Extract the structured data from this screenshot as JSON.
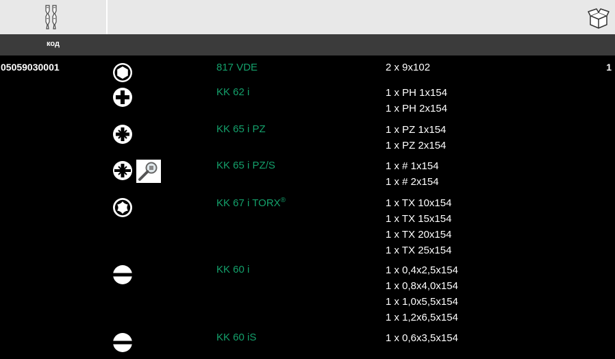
{
  "header": {
    "code_label": "код",
    "bits_icon": "screwdriver-bits-icon",
    "box_icon": "package-box-icon"
  },
  "product": {
    "article": "05059030001",
    "quantity": "1"
  },
  "rows": [
    {
      "icon": "hex-icon",
      "name": "817 VDE",
      "specs": [
        "2 x 9x102"
      ]
    },
    {
      "icon": "phillips-icon",
      "name": "KK 62 i",
      "specs": [
        "1 x PH 1x154",
        "1 x PH 2x154"
      ]
    },
    {
      "icon": "pozidriv-icon",
      "name": "KK 65 i PZ",
      "specs": [
        "1 x PZ 1x154",
        "1 x PZ 2x154"
      ]
    },
    {
      "icon": "plus-minus-icon",
      "name": "KK 65 i PZ/S",
      "specs": [
        "1 x # 1x154",
        "1 x # 2x154"
      ]
    },
    {
      "icon": "torx-icon",
      "name": "KK 67 i TORX",
      "name_sup": "®",
      "specs": [
        "1 x TX 10x154",
        "1 x TX 15x154",
        "1 x TX 20x154",
        "1 x TX 25x154"
      ]
    },
    {
      "icon": "slotted-icon",
      "name": "KK 60 i",
      "specs": [
        "1 x 0,4x2,5x154",
        "1 x 0,8x4,0x154",
        "1 x 1,0x5,5x154",
        "1 x 1,2x6,5x154"
      ]
    },
    {
      "icon": "slotted-icon",
      "name": "KK 60 iS",
      "specs": [
        "1 x 0,6x3,5x154"
      ]
    }
  ]
}
